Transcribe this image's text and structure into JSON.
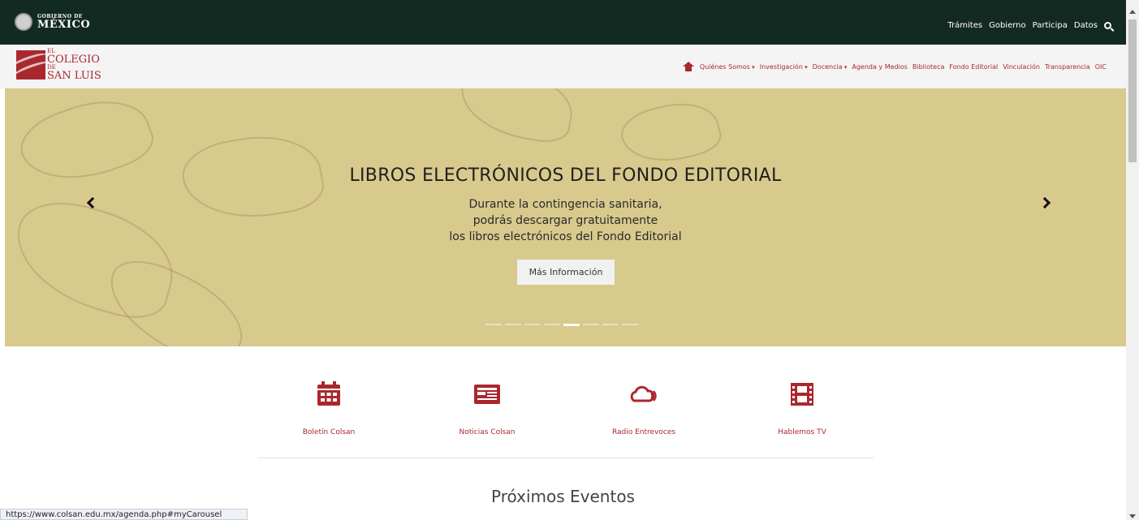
{
  "gov_bar": {
    "logo_small": "GOBIERNO DE",
    "logo_big": "MÉXICO",
    "links": [
      "Trámites",
      "Gobierno",
      "Participa",
      "Datos"
    ]
  },
  "site_nav": {
    "logo_l1": "EL",
    "logo_l2": "COLEGIO",
    "logo_l3": "DE",
    "logo_l4": "SAN LUIS",
    "items": [
      {
        "label": "Quiénes Somos",
        "dropdown": true
      },
      {
        "label": "Investigación",
        "dropdown": true
      },
      {
        "label": "Docencia",
        "dropdown": true
      },
      {
        "label": "Agenda y Medios",
        "dropdown": false
      },
      {
        "label": "Biblioteca",
        "dropdown": false
      },
      {
        "label": "Fondo Editorial",
        "dropdown": false
      },
      {
        "label": "Vinculación",
        "dropdown": false
      },
      {
        "label": "Transparencia",
        "dropdown": false
      },
      {
        "label": "OIC",
        "dropdown": false
      }
    ]
  },
  "hero": {
    "title": "LIBROS ELECTRÓNICOS DEL FONDO EDITORIAL",
    "desc_line1": "Durante la contingencia sanitaria,",
    "desc_line2": "podrás descargar gratuitamente",
    "desc_line3": "los libros electrónicos del Fondo Editorial",
    "button_label": "Más Información",
    "indicator_count": 8,
    "active_indicator": 4
  },
  "quick_links": [
    {
      "label": "Boletín Colsan",
      "icon": "calendar-icon"
    },
    {
      "label": "Noticias Colsan",
      "icon": "newspaper-icon"
    },
    {
      "label": "Radio Entrevoces",
      "icon": "cloud-broadcast-icon"
    },
    {
      "label": "Hablemos TV",
      "icon": "film-icon"
    }
  ],
  "events": {
    "title": "Próximos Eventos"
  },
  "status_bar": {
    "url": "https://www.colsan.edu.mx/agenda.php#myCarousel"
  },
  "colors": {
    "brand_red": "#a9282e",
    "gov_green": "#132a23",
    "hero_bg": "#d8c98d"
  }
}
